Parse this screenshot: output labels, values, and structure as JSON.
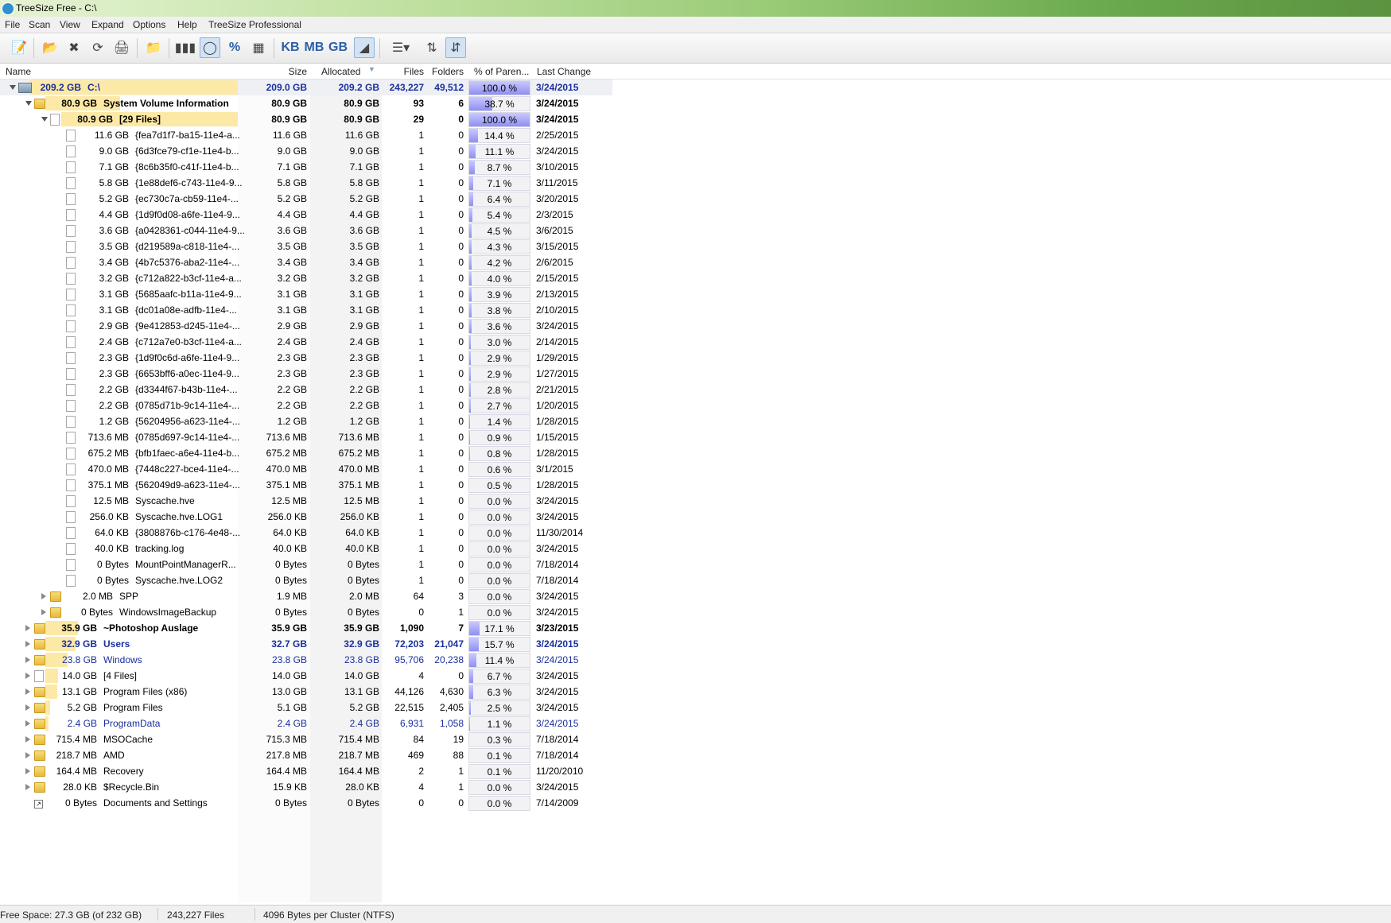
{
  "window": {
    "title": "TreeSize Free - C:\\"
  },
  "menu": [
    "File",
    "Scan",
    "View",
    "Expand",
    "Options",
    "Help",
    "TreeSize Professional"
  ],
  "toolbar": {
    "kb_label": "KB",
    "mb_label": "MB",
    "gb_label": "GB",
    "percent_label": "%"
  },
  "columns": {
    "name": "Name",
    "size": "Size",
    "allocated": "Allocated",
    "files": "Files",
    "folders": "Folders",
    "percent": "% of Paren...",
    "last_change": "Last Change"
  },
  "colors": {
    "size_highlight": "#fde9a6",
    "percent_bar": "#8f8ff2",
    "blue_text": "#1a2f9e"
  },
  "rows": [
    {
      "alloc": "209.2 GB",
      "name": "C:\\",
      "size": "209.0 GB",
      "allocated": "209.2 GB",
      "files": "243,227",
      "folders": "49,512",
      "pct": "100.0 %",
      "pv": 100,
      "date": "3/24/2015",
      "level": 0,
      "icon": "drive",
      "toggle": "open",
      "bold": true,
      "blue": true,
      "hl": 1.0
    },
    {
      "alloc": "80.9 GB",
      "name": "System Volume Information",
      "size": "80.9 GB",
      "allocated": "80.9 GB",
      "files": "93",
      "folders": "6",
      "pct": "38.7 %",
      "pv": 38.7,
      "date": "3/24/2015",
      "level": 1,
      "icon": "folder",
      "toggle": "open",
      "bold": true,
      "blue": false,
      "hl": 0.387
    },
    {
      "alloc": "80.9 GB",
      "name": "[29 Files]",
      "size": "80.9 GB",
      "allocated": "80.9 GB",
      "files": "29",
      "folders": "0",
      "pct": "100.0 %",
      "pv": 100,
      "date": "3/24/2015",
      "level": 2,
      "icon": "file",
      "toggle": "open",
      "bold": true,
      "blue": false,
      "hl": 1.0
    },
    {
      "alloc": "11.6 GB",
      "name": "{fea7d1f7-ba15-11e4-a...",
      "size": "11.6 GB",
      "allocated": "11.6 GB",
      "files": "1",
      "folders": "0",
      "pct": "14.4 %",
      "pv": 14.4,
      "date": "2/25/2015",
      "level": 3,
      "icon": "file",
      "toggle": "none",
      "bold": false,
      "blue": false,
      "hl": 0
    },
    {
      "alloc": "9.0 GB",
      "name": "{6d3fce79-cf1e-11e4-b...",
      "size": "9.0 GB",
      "allocated": "9.0 GB",
      "files": "1",
      "folders": "0",
      "pct": "11.1 %",
      "pv": 11.1,
      "date": "3/24/2015",
      "level": 3,
      "icon": "file",
      "toggle": "none",
      "bold": false,
      "blue": false,
      "hl": 0
    },
    {
      "alloc": "7.1 GB",
      "name": "{8c6b35f0-c41f-11e4-b...",
      "size": "7.1 GB",
      "allocated": "7.1 GB",
      "files": "1",
      "folders": "0",
      "pct": "8.7 %",
      "pv": 8.7,
      "date": "3/10/2015",
      "level": 3,
      "icon": "file",
      "toggle": "none",
      "bold": false,
      "blue": false,
      "hl": 0
    },
    {
      "alloc": "5.8 GB",
      "name": "{1e88def6-c743-11e4-9...",
      "size": "5.8 GB",
      "allocated": "5.8 GB",
      "files": "1",
      "folders": "0",
      "pct": "7.1 %",
      "pv": 7.1,
      "date": "3/11/2015",
      "level": 3,
      "icon": "file",
      "toggle": "none",
      "bold": false,
      "blue": false,
      "hl": 0
    },
    {
      "alloc": "5.2 GB",
      "name": "{ec730c7a-cb59-11e4-...",
      "size": "5.2 GB",
      "allocated": "5.2 GB",
      "files": "1",
      "folders": "0",
      "pct": "6.4 %",
      "pv": 6.4,
      "date": "3/20/2015",
      "level": 3,
      "icon": "file",
      "toggle": "none",
      "bold": false,
      "blue": false,
      "hl": 0
    },
    {
      "alloc": "4.4 GB",
      "name": "{1d9f0d08-a6fe-11e4-9...",
      "size": "4.4 GB",
      "allocated": "4.4 GB",
      "files": "1",
      "folders": "0",
      "pct": "5.4 %",
      "pv": 5.4,
      "date": "2/3/2015",
      "level": 3,
      "icon": "file",
      "toggle": "none",
      "bold": false,
      "blue": false,
      "hl": 0
    },
    {
      "alloc": "3.6 GB",
      "name": "{a0428361-c044-11e4-9...",
      "size": "3.6 GB",
      "allocated": "3.6 GB",
      "files": "1",
      "folders": "0",
      "pct": "4.5 %",
      "pv": 4.5,
      "date": "3/6/2015",
      "level": 3,
      "icon": "file",
      "toggle": "none",
      "bold": false,
      "blue": false,
      "hl": 0
    },
    {
      "alloc": "3.5 GB",
      "name": "{d219589a-c818-11e4-...",
      "size": "3.5 GB",
      "allocated": "3.5 GB",
      "files": "1",
      "folders": "0",
      "pct": "4.3 %",
      "pv": 4.3,
      "date": "3/15/2015",
      "level": 3,
      "icon": "file",
      "toggle": "none",
      "bold": false,
      "blue": false,
      "hl": 0
    },
    {
      "alloc": "3.4 GB",
      "name": "{4b7c5376-aba2-11e4-...",
      "size": "3.4 GB",
      "allocated": "3.4 GB",
      "files": "1",
      "folders": "0",
      "pct": "4.2 %",
      "pv": 4.2,
      "date": "2/6/2015",
      "level": 3,
      "icon": "file",
      "toggle": "none",
      "bold": false,
      "blue": false,
      "hl": 0
    },
    {
      "alloc": "3.2 GB",
      "name": "{c712a822-b3cf-11e4-a...",
      "size": "3.2 GB",
      "allocated": "3.2 GB",
      "files": "1",
      "folders": "0",
      "pct": "4.0 %",
      "pv": 4.0,
      "date": "2/15/2015",
      "level": 3,
      "icon": "file",
      "toggle": "none",
      "bold": false,
      "blue": false,
      "hl": 0
    },
    {
      "alloc": "3.1 GB",
      "name": "{5685aafc-b11a-11e4-9...",
      "size": "3.1 GB",
      "allocated": "3.1 GB",
      "files": "1",
      "folders": "0",
      "pct": "3.9 %",
      "pv": 3.9,
      "date": "2/13/2015",
      "level": 3,
      "icon": "file",
      "toggle": "none",
      "bold": false,
      "blue": false,
      "hl": 0
    },
    {
      "alloc": "3.1 GB",
      "name": "{dc01a08e-adfb-11e4-...",
      "size": "3.1 GB",
      "allocated": "3.1 GB",
      "files": "1",
      "folders": "0",
      "pct": "3.8 %",
      "pv": 3.8,
      "date": "2/10/2015",
      "level": 3,
      "icon": "file",
      "toggle": "none",
      "bold": false,
      "blue": false,
      "hl": 0
    },
    {
      "alloc": "2.9 GB",
      "name": "{9e412853-d245-11e4-...",
      "size": "2.9 GB",
      "allocated": "2.9 GB",
      "files": "1",
      "folders": "0",
      "pct": "3.6 %",
      "pv": 3.6,
      "date": "3/24/2015",
      "level": 3,
      "icon": "file",
      "toggle": "none",
      "bold": false,
      "blue": false,
      "hl": 0
    },
    {
      "alloc": "2.4 GB",
      "name": "{c712a7e0-b3cf-11e4-a...",
      "size": "2.4 GB",
      "allocated": "2.4 GB",
      "files": "1",
      "folders": "0",
      "pct": "3.0 %",
      "pv": 3.0,
      "date": "2/14/2015",
      "level": 3,
      "icon": "file",
      "toggle": "none",
      "bold": false,
      "blue": false,
      "hl": 0
    },
    {
      "alloc": "2.3 GB",
      "name": "{1d9f0c6d-a6fe-11e4-9...",
      "size": "2.3 GB",
      "allocated": "2.3 GB",
      "files": "1",
      "folders": "0",
      "pct": "2.9 %",
      "pv": 2.9,
      "date": "1/29/2015",
      "level": 3,
      "icon": "file",
      "toggle": "none",
      "bold": false,
      "blue": false,
      "hl": 0
    },
    {
      "alloc": "2.3 GB",
      "name": "{6653bff6-a0ec-11e4-9...",
      "size": "2.3 GB",
      "allocated": "2.3 GB",
      "files": "1",
      "folders": "0",
      "pct": "2.9 %",
      "pv": 2.9,
      "date": "1/27/2015",
      "level": 3,
      "icon": "file",
      "toggle": "none",
      "bold": false,
      "blue": false,
      "hl": 0
    },
    {
      "alloc": "2.2 GB",
      "name": "{d3344f67-b43b-11e4-...",
      "size": "2.2 GB",
      "allocated": "2.2 GB",
      "files": "1",
      "folders": "0",
      "pct": "2.8 %",
      "pv": 2.8,
      "date": "2/21/2015",
      "level": 3,
      "icon": "file",
      "toggle": "none",
      "bold": false,
      "blue": false,
      "hl": 0
    },
    {
      "alloc": "2.2 GB",
      "name": "{0785d71b-9c14-11e4-...",
      "size": "2.2 GB",
      "allocated": "2.2 GB",
      "files": "1",
      "folders": "0",
      "pct": "2.7 %",
      "pv": 2.7,
      "date": "1/20/2015",
      "level": 3,
      "icon": "file",
      "toggle": "none",
      "bold": false,
      "blue": false,
      "hl": 0
    },
    {
      "alloc": "1.2 GB",
      "name": "{56204956-a623-11e4-...",
      "size": "1.2 GB",
      "allocated": "1.2 GB",
      "files": "1",
      "folders": "0",
      "pct": "1.4 %",
      "pv": 1.4,
      "date": "1/28/2015",
      "level": 3,
      "icon": "file",
      "toggle": "none",
      "bold": false,
      "blue": false,
      "hl": 0
    },
    {
      "alloc": "713.6 MB",
      "name": "{0785d697-9c14-11e4-...",
      "size": "713.6 MB",
      "allocated": "713.6 MB",
      "files": "1",
      "folders": "0",
      "pct": "0.9 %",
      "pv": 0.9,
      "date": "1/15/2015",
      "level": 3,
      "icon": "file",
      "toggle": "none",
      "bold": false,
      "blue": false,
      "hl": 0
    },
    {
      "alloc": "675.2 MB",
      "name": "{bfb1faec-a6e4-11e4-b...",
      "size": "675.2 MB",
      "allocated": "675.2 MB",
      "files": "1",
      "folders": "0",
      "pct": "0.8 %",
      "pv": 0.8,
      "date": "1/28/2015",
      "level": 3,
      "icon": "file",
      "toggle": "none",
      "bold": false,
      "blue": false,
      "hl": 0
    },
    {
      "alloc": "470.0 MB",
      "name": "{7448c227-bce4-11e4-...",
      "size": "470.0 MB",
      "allocated": "470.0 MB",
      "files": "1",
      "folders": "0",
      "pct": "0.6 %",
      "pv": 0.6,
      "date": "3/1/2015",
      "level": 3,
      "icon": "file",
      "toggle": "none",
      "bold": false,
      "blue": false,
      "hl": 0
    },
    {
      "alloc": "375.1 MB",
      "name": "{562049d9-a623-11e4-...",
      "size": "375.1 MB",
      "allocated": "375.1 MB",
      "files": "1",
      "folders": "0",
      "pct": "0.5 %",
      "pv": 0.5,
      "date": "1/28/2015",
      "level": 3,
      "icon": "file",
      "toggle": "none",
      "bold": false,
      "blue": false,
      "hl": 0
    },
    {
      "alloc": "12.5 MB",
      "name": "Syscache.hve",
      "size": "12.5 MB",
      "allocated": "12.5 MB",
      "files": "1",
      "folders": "0",
      "pct": "0.0 %",
      "pv": 0,
      "date": "3/24/2015",
      "level": 3,
      "icon": "file",
      "toggle": "none",
      "bold": false,
      "blue": false,
      "hl": 0
    },
    {
      "alloc": "256.0 KB",
      "name": "Syscache.hve.LOG1",
      "size": "256.0 KB",
      "allocated": "256.0 KB",
      "files": "1",
      "folders": "0",
      "pct": "0.0 %",
      "pv": 0,
      "date": "3/24/2015",
      "level": 3,
      "icon": "file",
      "toggle": "none",
      "bold": false,
      "blue": false,
      "hl": 0
    },
    {
      "alloc": "64.0 KB",
      "name": "{3808876b-c176-4e48-...",
      "size": "64.0 KB",
      "allocated": "64.0 KB",
      "files": "1",
      "folders": "0",
      "pct": "0.0 %",
      "pv": 0,
      "date": "11/30/2014",
      "level": 3,
      "icon": "file",
      "toggle": "none",
      "bold": false,
      "blue": false,
      "hl": 0
    },
    {
      "alloc": "40.0 KB",
      "name": "tracking.log",
      "size": "40.0 KB",
      "allocated": "40.0 KB",
      "files": "1",
      "folders": "0",
      "pct": "0.0 %",
      "pv": 0,
      "date": "3/24/2015",
      "level": 3,
      "icon": "file",
      "toggle": "none",
      "bold": false,
      "blue": false,
      "hl": 0
    },
    {
      "alloc": "0 Bytes",
      "name": "MountPointManagerR...",
      "size": "0 Bytes",
      "allocated": "0 Bytes",
      "files": "1",
      "folders": "0",
      "pct": "0.0 %",
      "pv": 0,
      "date": "7/18/2014",
      "level": 3,
      "icon": "file",
      "toggle": "none",
      "bold": false,
      "blue": false,
      "hl": 0
    },
    {
      "alloc": "0 Bytes",
      "name": "Syscache.hve.LOG2",
      "size": "0 Bytes",
      "allocated": "0 Bytes",
      "files": "1",
      "folders": "0",
      "pct": "0.0 %",
      "pv": 0,
      "date": "7/18/2014",
      "level": 3,
      "icon": "file",
      "toggle": "none",
      "bold": false,
      "blue": false,
      "hl": 0
    },
    {
      "alloc": "2.0 MB",
      "name": "SPP",
      "size": "1.9 MB",
      "allocated": "2.0 MB",
      "files": "64",
      "folders": "3",
      "pct": "0.0 %",
      "pv": 0,
      "date": "3/24/2015",
      "level": 2,
      "icon": "folder",
      "toggle": "closed",
      "bold": false,
      "blue": false,
      "hl": 0
    },
    {
      "alloc": "0 Bytes",
      "name": "WindowsImageBackup",
      "size": "0 Bytes",
      "allocated": "0 Bytes",
      "files": "0",
      "folders": "1",
      "pct": "0.0 %",
      "pv": 0,
      "date": "3/24/2015",
      "level": 2,
      "icon": "folder",
      "toggle": "closed",
      "bold": false,
      "blue": false,
      "hl": 0
    },
    {
      "alloc": "35.9 GB",
      "name": "~Photoshop Auslage",
      "size": "35.9 GB",
      "allocated": "35.9 GB",
      "files": "1,090",
      "folders": "7",
      "pct": "17.1 %",
      "pv": 17.1,
      "date": "3/23/2015",
      "level": 1,
      "icon": "folder",
      "toggle": "closed",
      "bold": true,
      "blue": false,
      "hl": 0.171
    },
    {
      "alloc": "32.9 GB",
      "name": "Users",
      "size": "32.7 GB",
      "allocated": "32.9 GB",
      "files": "72,203",
      "folders": "21,047",
      "pct": "15.7 %",
      "pv": 15.7,
      "date": "3/24/2015",
      "level": 1,
      "icon": "folder",
      "toggle": "closed",
      "bold": true,
      "blue": true,
      "hl": 0.157
    },
    {
      "alloc": "23.8 GB",
      "name": "Windows",
      "size": "23.8 GB",
      "allocated": "23.8 GB",
      "files": "95,706",
      "folders": "20,238",
      "pct": "11.4 %",
      "pv": 11.4,
      "date": "3/24/2015",
      "level": 1,
      "icon": "folder",
      "toggle": "closed",
      "bold": false,
      "blue": true,
      "hl": 0.114
    },
    {
      "alloc": "14.0 GB",
      "name": "[4 Files]",
      "size": "14.0 GB",
      "allocated": "14.0 GB",
      "files": "4",
      "folders": "0",
      "pct": "6.7 %",
      "pv": 6.7,
      "date": "3/24/2015",
      "level": 1,
      "icon": "file",
      "toggle": "closed",
      "bold": false,
      "blue": false,
      "hl": 0.067
    },
    {
      "alloc": "13.1 GB",
      "name": "Program Files (x86)",
      "size": "13.0 GB",
      "allocated": "13.1 GB",
      "files": "44,126",
      "folders": "4,630",
      "pct": "6.3 %",
      "pv": 6.3,
      "date": "3/24/2015",
      "level": 1,
      "icon": "folder",
      "toggle": "closed",
      "bold": false,
      "blue": false,
      "hl": 0.063
    },
    {
      "alloc": "5.2 GB",
      "name": "Program Files",
      "size": "5.1 GB",
      "allocated": "5.2 GB",
      "files": "22,515",
      "folders": "2,405",
      "pct": "2.5 %",
      "pv": 2.5,
      "date": "3/24/2015",
      "level": 1,
      "icon": "folder",
      "toggle": "closed",
      "bold": false,
      "blue": false,
      "hl": 0.025
    },
    {
      "alloc": "2.4 GB",
      "name": "ProgramData",
      "size": "2.4 GB",
      "allocated": "2.4 GB",
      "files": "6,931",
      "folders": "1,058",
      "pct": "1.1 %",
      "pv": 1.1,
      "date": "3/24/2015",
      "level": 1,
      "icon": "folder",
      "toggle": "closed",
      "bold": false,
      "blue": true,
      "hl": 0.011
    },
    {
      "alloc": "715.4 MB",
      "name": "MSOCache",
      "size": "715.3 MB",
      "allocated": "715.4 MB",
      "files": "84",
      "folders": "19",
      "pct": "0.3 %",
      "pv": 0.3,
      "date": "7/18/2014",
      "level": 1,
      "icon": "folder",
      "toggle": "closed",
      "bold": false,
      "blue": false,
      "hl": 0
    },
    {
      "alloc": "218.7 MB",
      "name": "AMD",
      "size": "217.8 MB",
      "allocated": "218.7 MB",
      "files": "469",
      "folders": "88",
      "pct": "0.1 %",
      "pv": 0.1,
      "date": "7/18/2014",
      "level": 1,
      "icon": "folder",
      "toggle": "closed",
      "bold": false,
      "blue": false,
      "hl": 0
    },
    {
      "alloc": "164.4 MB",
      "name": "Recovery",
      "size": "164.4 MB",
      "allocated": "164.4 MB",
      "files": "2",
      "folders": "1",
      "pct": "0.1 %",
      "pv": 0.1,
      "date": "11/20/2010",
      "level": 1,
      "icon": "folder",
      "toggle": "closed",
      "bold": false,
      "blue": false,
      "hl": 0
    },
    {
      "alloc": "28.0 KB",
      "name": "$Recycle.Bin",
      "size": "15.9 KB",
      "allocated": "28.0 KB",
      "files": "4",
      "folders": "1",
      "pct": "0.0 %",
      "pv": 0,
      "date": "3/24/2015",
      "level": 1,
      "icon": "folder",
      "toggle": "closed",
      "bold": false,
      "blue": false,
      "hl": 0
    },
    {
      "alloc": "0 Bytes",
      "name": "Documents and Settings",
      "size": "0 Bytes",
      "allocated": "0 Bytes",
      "files": "0",
      "folders": "0",
      "pct": "0.0 %",
      "pv": 0,
      "date": "7/14/2009",
      "level": 1,
      "icon": "link",
      "toggle": "none",
      "bold": false,
      "blue": false,
      "hl": 0
    }
  ],
  "status": {
    "free_space": "Free Space: 27.3 GB  (of 232 GB)",
    "files": "243,227  Files",
    "cluster": "4096 Bytes per Cluster (NTFS)"
  }
}
